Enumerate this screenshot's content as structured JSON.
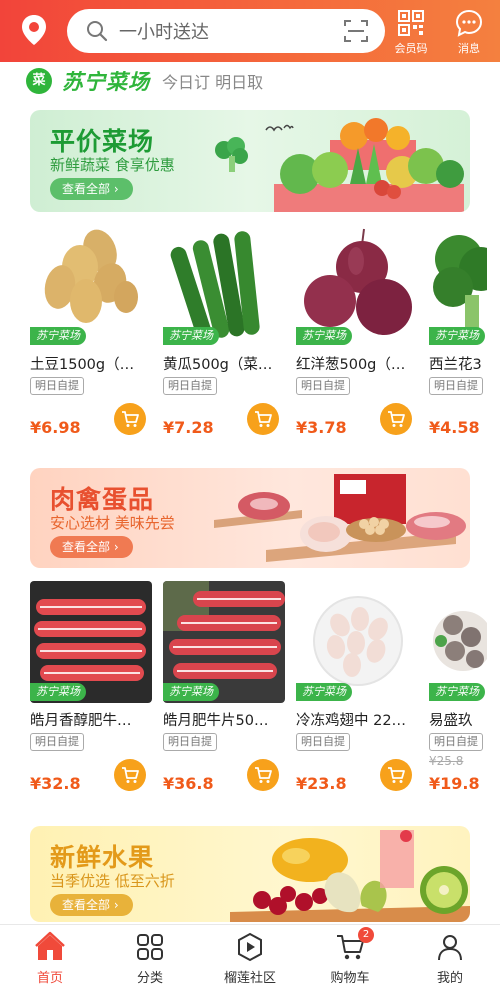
{
  "header": {
    "search_placeholder": "一小时送达",
    "member_code_label": "会员码",
    "message_label": "消息"
  },
  "store": {
    "badge": "菜",
    "brand": "苏宁菜场",
    "tagline": "今日订 明日取"
  },
  "banners": [
    {
      "title": "平价菜场",
      "subtitle": "新鲜蔬菜 食享优惠",
      "cta": "查看全部 ›"
    },
    {
      "title": "肉禽蛋品",
      "subtitle": "安心选材 美味先尝",
      "cta": "查看全部 ›"
    },
    {
      "title": "新鲜水果",
      "subtitle": "当季优选 低至六折",
      "cta": "查看全部 ›"
    }
  ],
  "product_tag": "苏宁菜场",
  "pickup_tag": "明日自提",
  "vegetables": [
    {
      "name": "土豆1500g（…",
      "price": "¥6.98"
    },
    {
      "name": "黄瓜500g（菜…",
      "price": "¥7.28"
    },
    {
      "name": "红洋葱500g（…",
      "price": "¥3.78"
    },
    {
      "name": "西兰花3",
      "price": "¥4.58"
    }
  ],
  "meats": [
    {
      "name": "皓月香醇肥牛…",
      "price": "¥32.8"
    },
    {
      "name": "皓月肥牛片50…",
      "price": "¥36.8"
    },
    {
      "name": "冷冻鸡翅中 22…",
      "price": "¥23.8"
    },
    {
      "name": "易盛玖",
      "price": "¥19.8",
      "old_price": "¥25.8"
    }
  ],
  "bottom_nav": {
    "items": [
      "首页",
      "分类",
      "榴莲社区",
      "购物车",
      "我的"
    ],
    "cart_badge": "2",
    "active_color": "#f04a3a"
  },
  "colors": {
    "brand_green": "#2fb53b",
    "price_orange": "#f05a1a",
    "header_red": "#f2443a",
    "cart_button": "#f7a11b"
  }
}
